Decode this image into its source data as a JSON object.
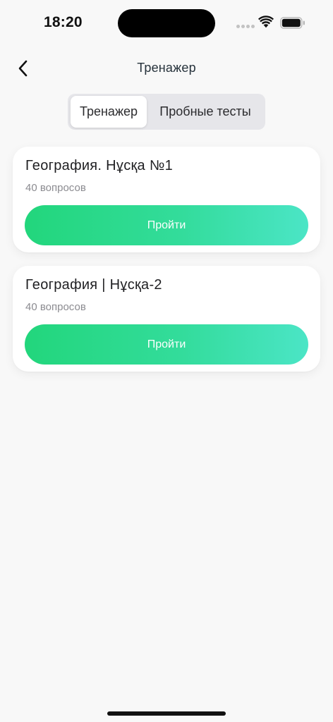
{
  "status_bar": {
    "time": "18:20"
  },
  "icons": {
    "back": "chevron-left-icon",
    "wifi": "wifi-icon",
    "battery": "battery-icon",
    "signal": "signal-dots-icon"
  },
  "nav": {
    "title": "Тренажер"
  },
  "tabs": [
    {
      "label": "Тренажер",
      "selected": true
    },
    {
      "label": "Пробные тесты",
      "selected": false
    }
  ],
  "tests": [
    {
      "title": "География. Нұсқа №1",
      "subtitle": "40 вопросов",
      "button_label": "Пройти"
    },
    {
      "title": "География | Нұсқа-2",
      "subtitle": "40 вопросов",
      "button_label": "Пройти"
    }
  ],
  "colors": {
    "gradient_start": "#22d67c",
    "gradient_end": "#4be5c6",
    "background": "#f8f8f8",
    "card": "#ffffff"
  }
}
